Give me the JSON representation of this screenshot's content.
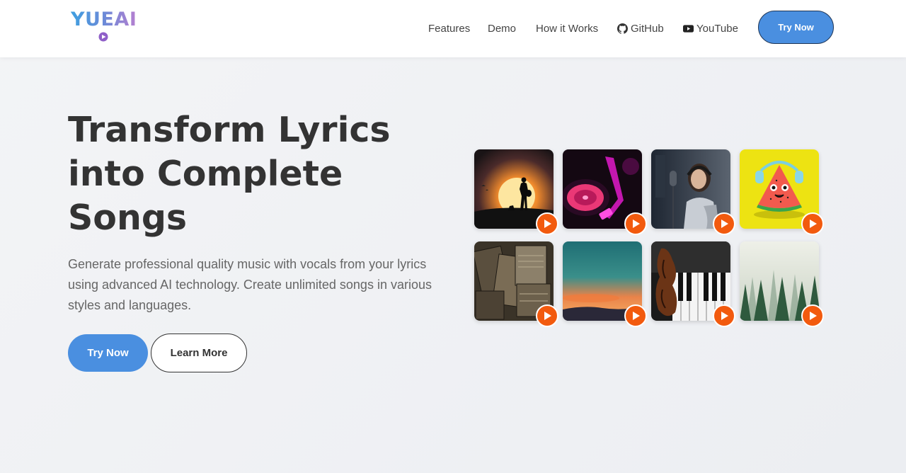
{
  "brand": {
    "name": "YUEAI"
  },
  "nav": {
    "items": [
      {
        "label": "Features"
      },
      {
        "label": "Demo"
      },
      {
        "label": "How it Works"
      },
      {
        "label": "GitHub",
        "icon": "github-icon"
      },
      {
        "label": "YouTube",
        "icon": "youtube-icon"
      }
    ],
    "cta_label": "Try Now"
  },
  "hero": {
    "title": "Transform Lyrics into Complete Songs",
    "subtitle": "Generate professional quality music with vocals from your lyrics using advanced AI technology. Create unlimited songs in various styles and languages.",
    "primary_label": "Try Now",
    "secondary_label": "Learn More"
  },
  "gallery": {
    "items": [
      {
        "art": "sunset-silhouette-guitarist",
        "icon": "play-icon"
      },
      {
        "art": "neon-vinyl-turntable",
        "icon": "play-icon"
      },
      {
        "art": "singer-in-studio",
        "icon": "play-icon"
      },
      {
        "art": "watermelon-with-headphones",
        "icon": "play-icon"
      },
      {
        "art": "vintage-records-stack",
        "icon": "play-icon"
      },
      {
        "art": "teal-orange-sunset-sky",
        "icon": "play-icon"
      },
      {
        "art": "violin-and-piano",
        "icon": "play-icon"
      },
      {
        "art": "misty-pine-forest",
        "icon": "play-icon"
      }
    ]
  },
  "colors": {
    "accent": "#4a8fe0",
    "play_button": "#f25a0e",
    "text_dark": "#333333",
    "text_muted": "#666666"
  }
}
